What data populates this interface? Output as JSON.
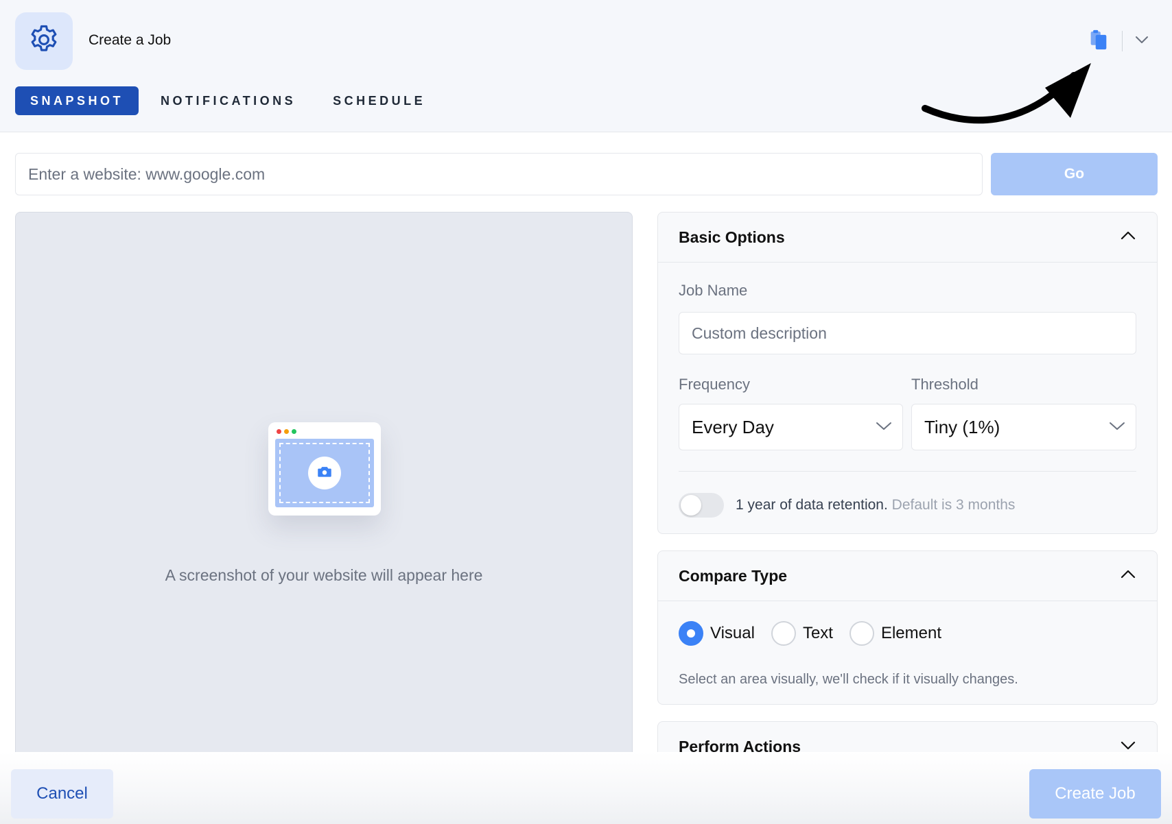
{
  "header": {
    "title": "Create a Job",
    "icons": {
      "app": "gear-icon",
      "clipboard": "clipboard-icon",
      "menu": "chevron-down-icon"
    },
    "accent": "#3b82f6",
    "tabs": [
      {
        "label": "SNAPSHOT",
        "active": true
      },
      {
        "label": "NOTIFICATIONS",
        "active": false
      },
      {
        "label": "SCHEDULE",
        "active": false
      }
    ]
  },
  "url_bar": {
    "placeholder": "Enter a website: www.google.com",
    "go_label": "Go"
  },
  "preview": {
    "caption": "A screenshot of your website will appear here"
  },
  "basic_options": {
    "title": "Basic Options",
    "job_name_label": "Job Name",
    "job_name_placeholder": "Custom description",
    "frequency_label": "Frequency",
    "frequency_value": "Every Day",
    "threshold_label": "Threshold",
    "threshold_value": "Tiny (1%)",
    "retention_text": "1 year of data retention.",
    "retention_note": "Default is 3 months",
    "retention_enabled": false
  },
  "compare_type": {
    "title": "Compare Type",
    "options": [
      {
        "label": "Visual",
        "selected": true
      },
      {
        "label": "Text",
        "selected": false
      },
      {
        "label": "Element",
        "selected": false
      }
    ],
    "help": "Select an area visually, we'll check if it visually changes."
  },
  "perform_actions": {
    "title": "Perform Actions"
  },
  "footer": {
    "cancel_label": "Cancel",
    "create_label": "Create Job"
  },
  "colors": {
    "primary": "#1e4fb4",
    "disabled_primary": "#a9c6f8",
    "header_bg": "#f5f7fb"
  }
}
